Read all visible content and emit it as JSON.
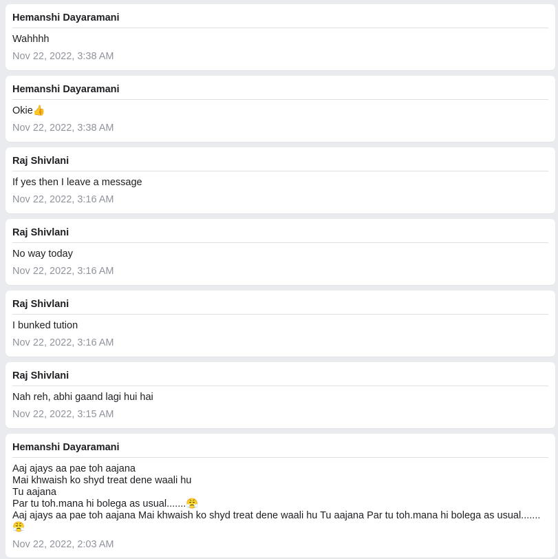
{
  "messages": [
    {
      "sender": "Hemanshi Dayaramani",
      "text": "Wahhhh",
      "time": "Nov 22, 2022, 3:38 AM"
    },
    {
      "sender": "Hemanshi Dayaramani",
      "text": "Okie👍",
      "time": "Nov 22, 2022, 3:38 AM"
    },
    {
      "sender": "Raj Shivlani",
      "text": "If yes then I leave a message",
      "time": "Nov 22, 2022, 3:16 AM"
    },
    {
      "sender": "Raj Shivlani",
      "text": "No way today",
      "time": "Nov 22, 2022, 3:16 AM"
    },
    {
      "sender": "Raj Shivlani",
      "text": "I bunked tution",
      "time": "Nov 22, 2022, 3:16 AM"
    },
    {
      "sender": "Raj Shivlani",
      "text": "Nah reh, abhi gaand lagi hui hai",
      "time": "Nov 22, 2022, 3:15 AM"
    },
    {
      "sender": "Hemanshi Dayaramani",
      "text": "Aaj ajays aa pae toh aajana\nMai khwaish ko shyd treat dene waali hu\nTu aajana\nPar tu toh.mana hi bolega as usual.......😤\nAaj ajays aa pae toh aajana Mai khwaish ko shyd treat dene waali hu Tu aajana Par tu toh.mana hi bolega as usual.......\n😤",
      "time": "Nov 22, 2022, 2:03 AM"
    }
  ]
}
